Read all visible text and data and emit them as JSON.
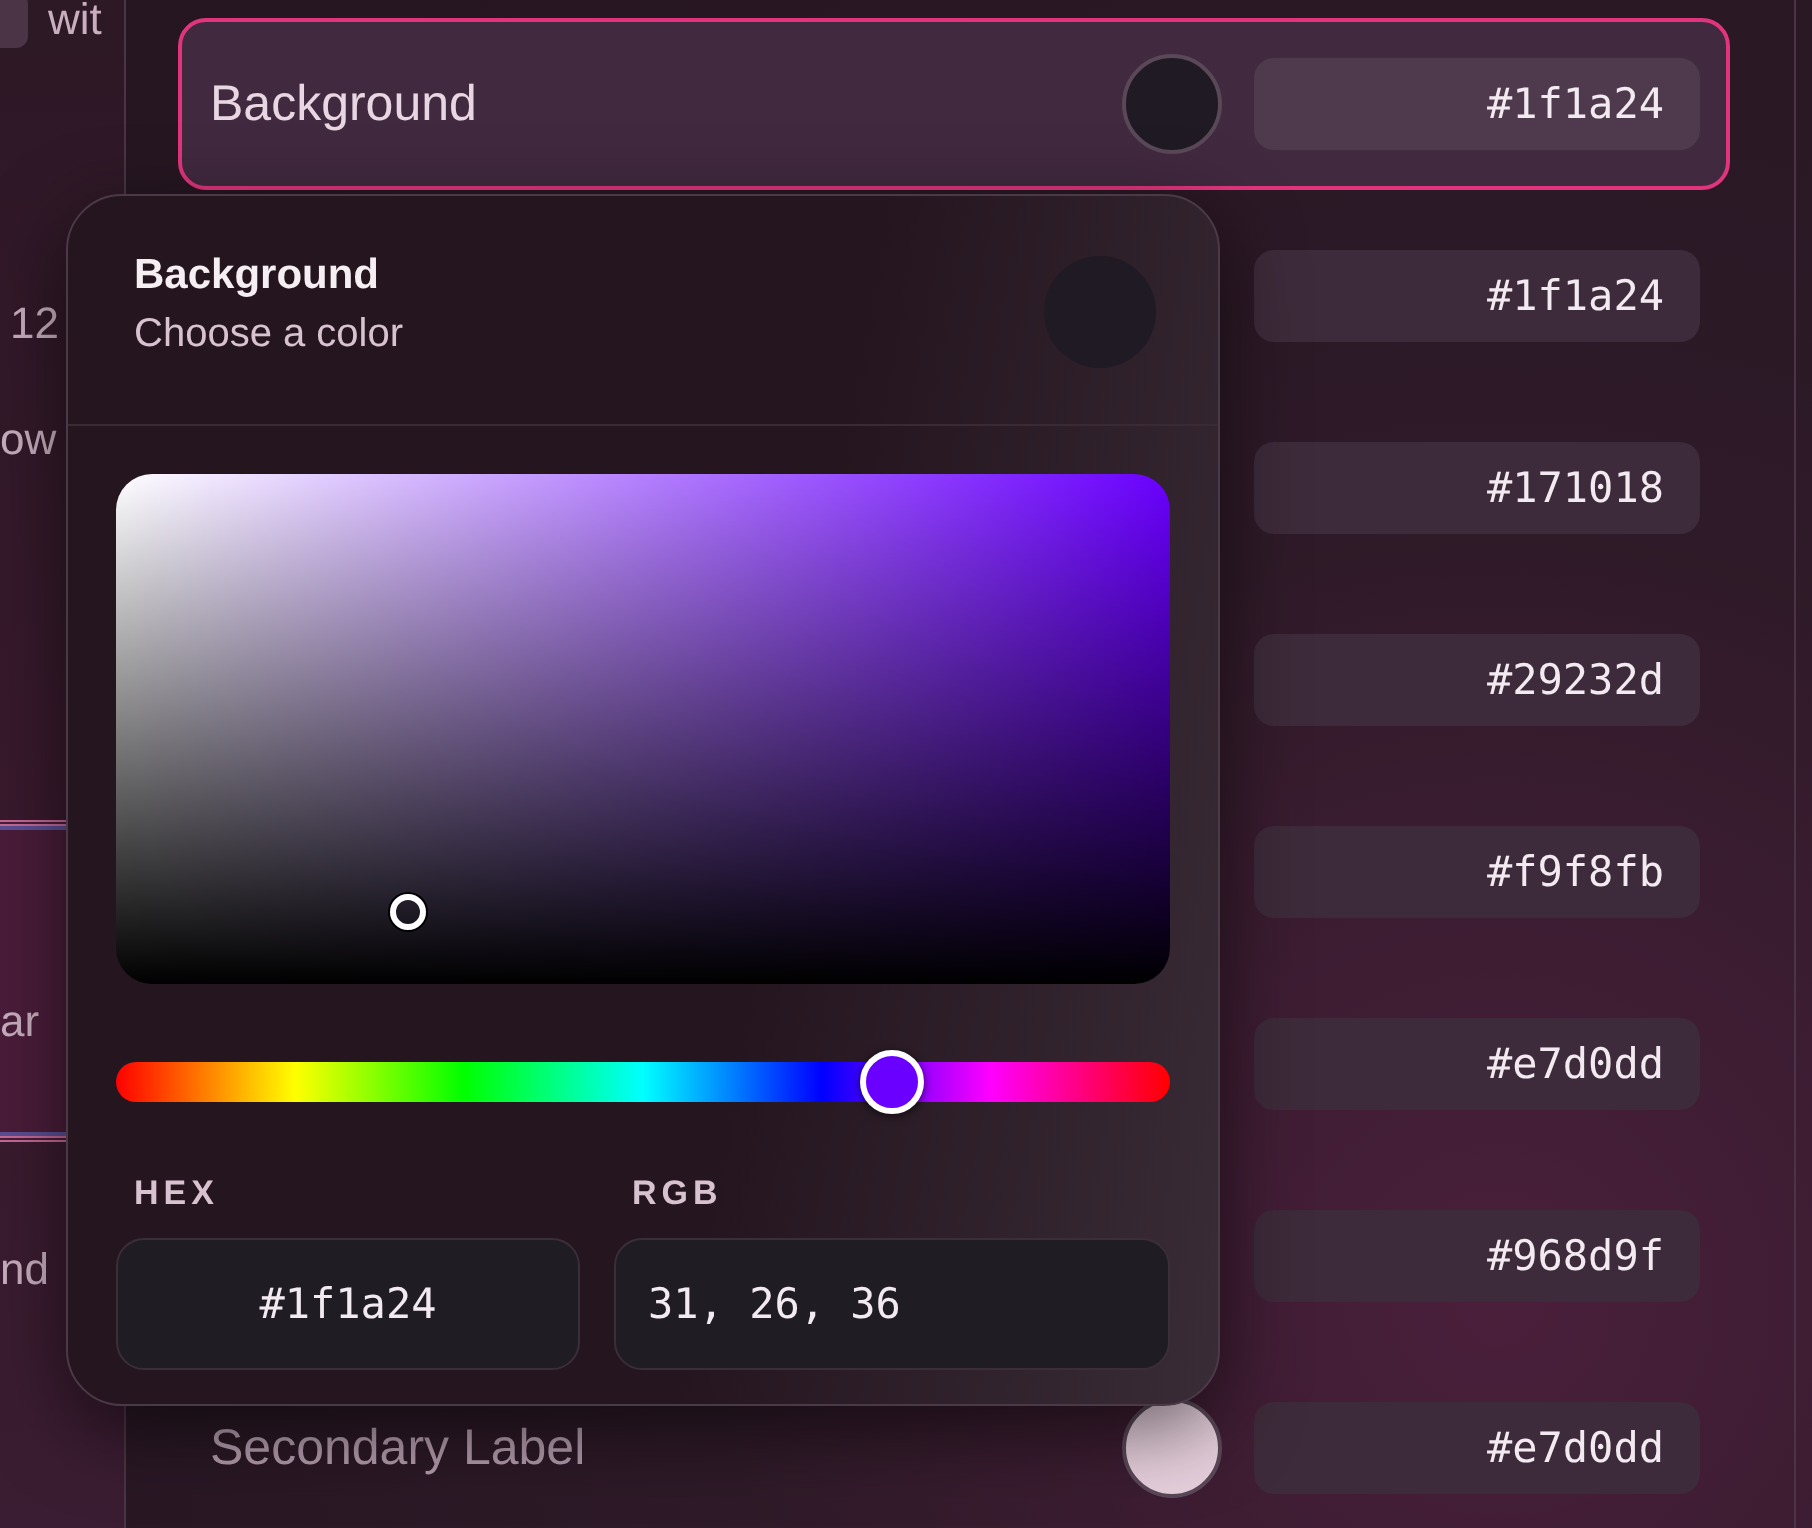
{
  "side_list": [
    {
      "text": "wit",
      "kind": "chip"
    },
    {
      "text": "12",
      "kind": "plain"
    },
    {
      "text": "ow",
      "kind": "plain"
    },
    {
      "text": "ar",
      "kind": "highlight"
    },
    {
      "text": "nd",
      "kind": "plain"
    }
  ],
  "rows": [
    {
      "label": "Background",
      "color": "#1f1a24",
      "hex": "#1f1a24",
      "selected": true
    },
    {
      "hex": "#1f1a24",
      "selected": false
    },
    {
      "hex": "#171018",
      "selected": false
    },
    {
      "hex": "#29232d",
      "selected": false
    },
    {
      "hex": "#f9f8fb",
      "selected": false
    },
    {
      "hex": "#e7d0dd",
      "selected": false
    },
    {
      "hex": "#968d9f",
      "selected": false
    },
    {
      "label": "Secondary Label",
      "color": "#e7d0dd",
      "hex": "#e7d0dd",
      "selected": false
    }
  ],
  "popover": {
    "title": "Background",
    "subtitle": "Choose a color",
    "hue": {
      "level": 0.736
    },
    "hex_label": "HEX",
    "hex_value": "#1f1a24",
    "rgb_label": "RGB",
    "rgb_value": "31, 26, 36"
  }
}
